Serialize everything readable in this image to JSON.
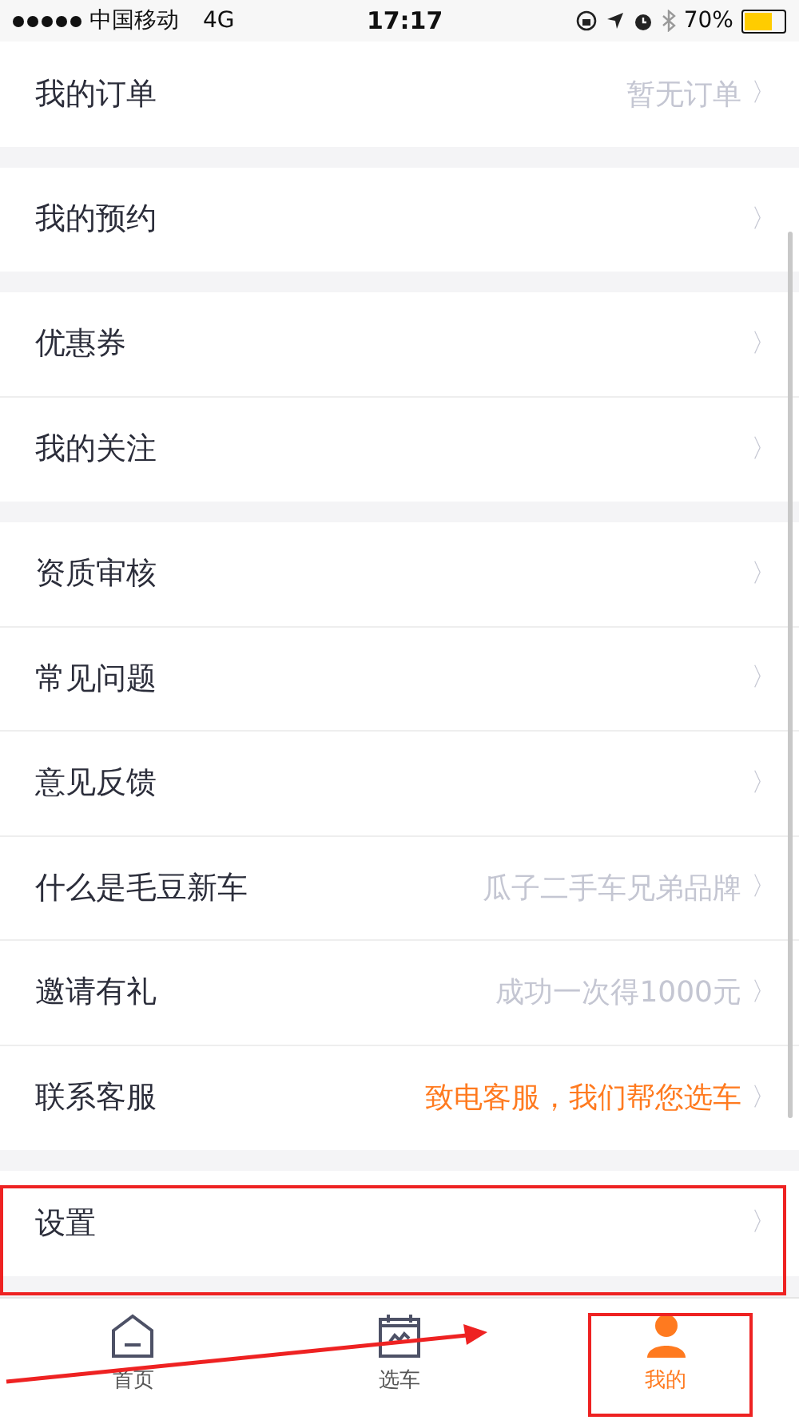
{
  "status_bar": {
    "carrier": "中国移动",
    "network": "4G",
    "time": "17:17",
    "battery": "70%"
  },
  "sections": [
    {
      "rows": [
        {
          "label": "我的订单",
          "value": "暂无订单",
          "highlighted": false
        }
      ]
    },
    {
      "rows": [
        {
          "label": "我的预约"
        }
      ]
    },
    {
      "rows": [
        {
          "label": "优惠券"
        },
        {
          "label": "我的关注"
        }
      ]
    },
    {
      "rows": [
        {
          "label": "资质审核"
        },
        {
          "label": "常见问题"
        },
        {
          "label": "意见反馈"
        },
        {
          "label": "什么是毛豆新车",
          "value": "瓜子二手车兄弟品牌",
          "highlighted": false
        },
        {
          "label": "邀请有礼",
          "value": "成功一次得1000元",
          "highlighted": false
        },
        {
          "label": "联系客服",
          "value": "致电客服，我们帮您选车",
          "highlighted": true
        }
      ]
    },
    {
      "rows": [
        {
          "label": "设置"
        }
      ]
    }
  ],
  "chevron": "〉",
  "tab_bar": [
    {
      "label": "首页",
      "kind": "home",
      "selected": false
    },
    {
      "label": "选车",
      "kind": "calendar",
      "selected": false
    },
    {
      "label": "我的",
      "kind": "person",
      "selected": true
    }
  ]
}
